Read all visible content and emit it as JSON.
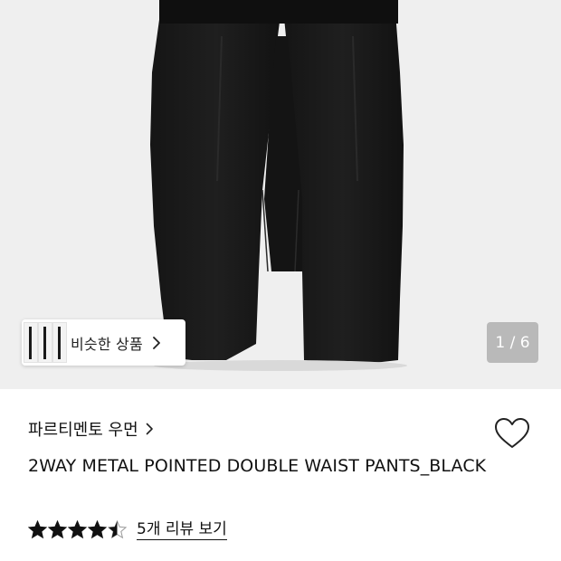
{
  "gallery": {
    "similar_products_label": "비슷한 상품",
    "image_counter": "1 / 6",
    "current_image": 1,
    "total_images": 6
  },
  "product": {
    "brand": "파르티멘토 우먼",
    "title": "2WAY METAL POINTED DOUBLE WAIST PANTS_BLACK",
    "rating": 4.5,
    "rating_max": 5,
    "review_link": "5개 리뷰 보기"
  },
  "icons": {
    "similar_chevron": "chevron-right-icon",
    "brand_chevron": "chevron-right-icon",
    "wishlist": "heart-outline-icon",
    "star": "star-icon"
  },
  "colors": {
    "image_background": "#efefef",
    "counter_background": "#b9b9b9",
    "text": "#111111",
    "star": "#111111"
  }
}
